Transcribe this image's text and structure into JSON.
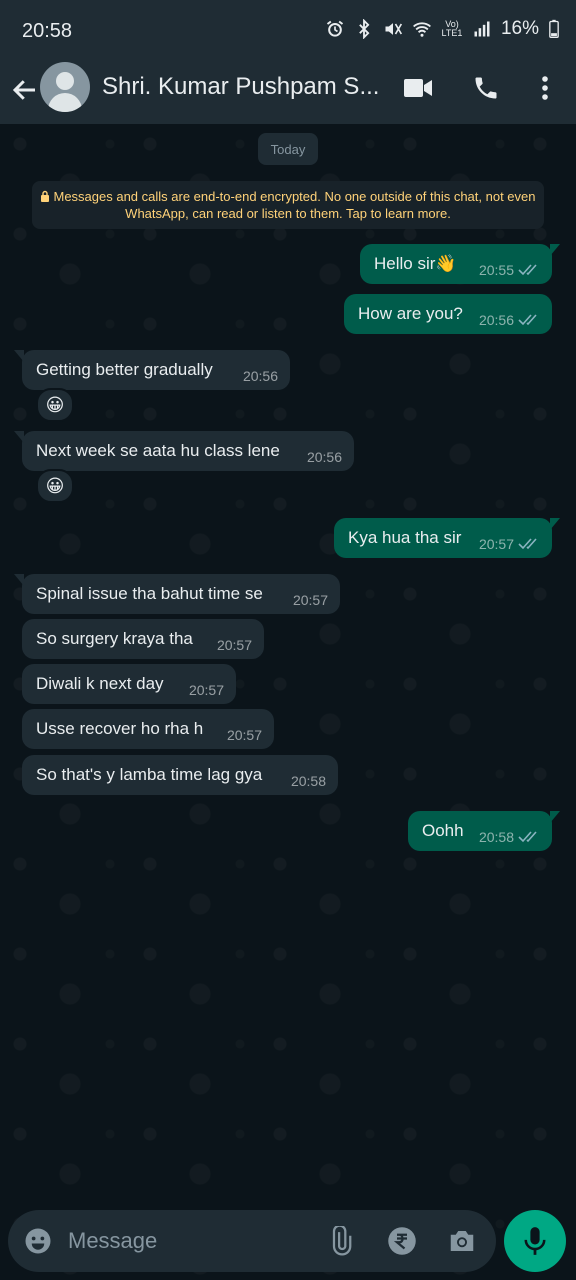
{
  "status_bar": {
    "time": "20:58",
    "network": "Vo) LTE1",
    "battery": "16%"
  },
  "header": {
    "contact_name": "Shri. Kumar Pushpam S..."
  },
  "chat": {
    "date_chip": "Today",
    "encryption_notice": "Messages and calls are end-to-end encrypted. No one outside of this chat, not even WhatsApp, can read or listen to them. Tap to learn more.",
    "messages": [
      {
        "dir": "out",
        "text": "Hello sir👋",
        "time": "20:55"
      },
      {
        "dir": "out",
        "text": "How are you?",
        "time": "20:56"
      },
      {
        "dir": "in",
        "text": "Getting better gradually",
        "time": "20:56",
        "reaction": "😀"
      },
      {
        "dir": "in",
        "text": "Next week se aata hu class lene",
        "time": "20:56",
        "reaction": "😀"
      },
      {
        "dir": "out",
        "text": "Kya hua tha sir",
        "time": "20:57"
      },
      {
        "dir": "in",
        "text": "Spinal issue tha bahut time se",
        "time": "20:57"
      },
      {
        "dir": "in",
        "text": "So surgery kraya tha",
        "time": "20:57"
      },
      {
        "dir": "in",
        "text": "Diwali k next day",
        "time": "20:57"
      },
      {
        "dir": "in",
        "text": "Usse recover ho rha h",
        "time": "20:57"
      },
      {
        "dir": "in",
        "text": "So that's y lamba time lag gya",
        "time": "20:58"
      },
      {
        "dir": "out",
        "text": "Oohh",
        "time": "20:58"
      }
    ]
  },
  "input": {
    "placeholder": "Message"
  },
  "colors": {
    "outgoing_bubble": "#005c4b",
    "incoming_bubble": "#1f2c34",
    "accent": "#00a884",
    "read_ticks": "#8ab4c0"
  },
  "icons": [
    "back-arrow-icon",
    "avatar-icon",
    "video-call-icon",
    "phone-icon",
    "more-options-icon",
    "emoji-icon",
    "attach-icon",
    "rupee-icon",
    "camera-icon",
    "mic-icon",
    "double-check-icon",
    "lock-icon"
  ]
}
